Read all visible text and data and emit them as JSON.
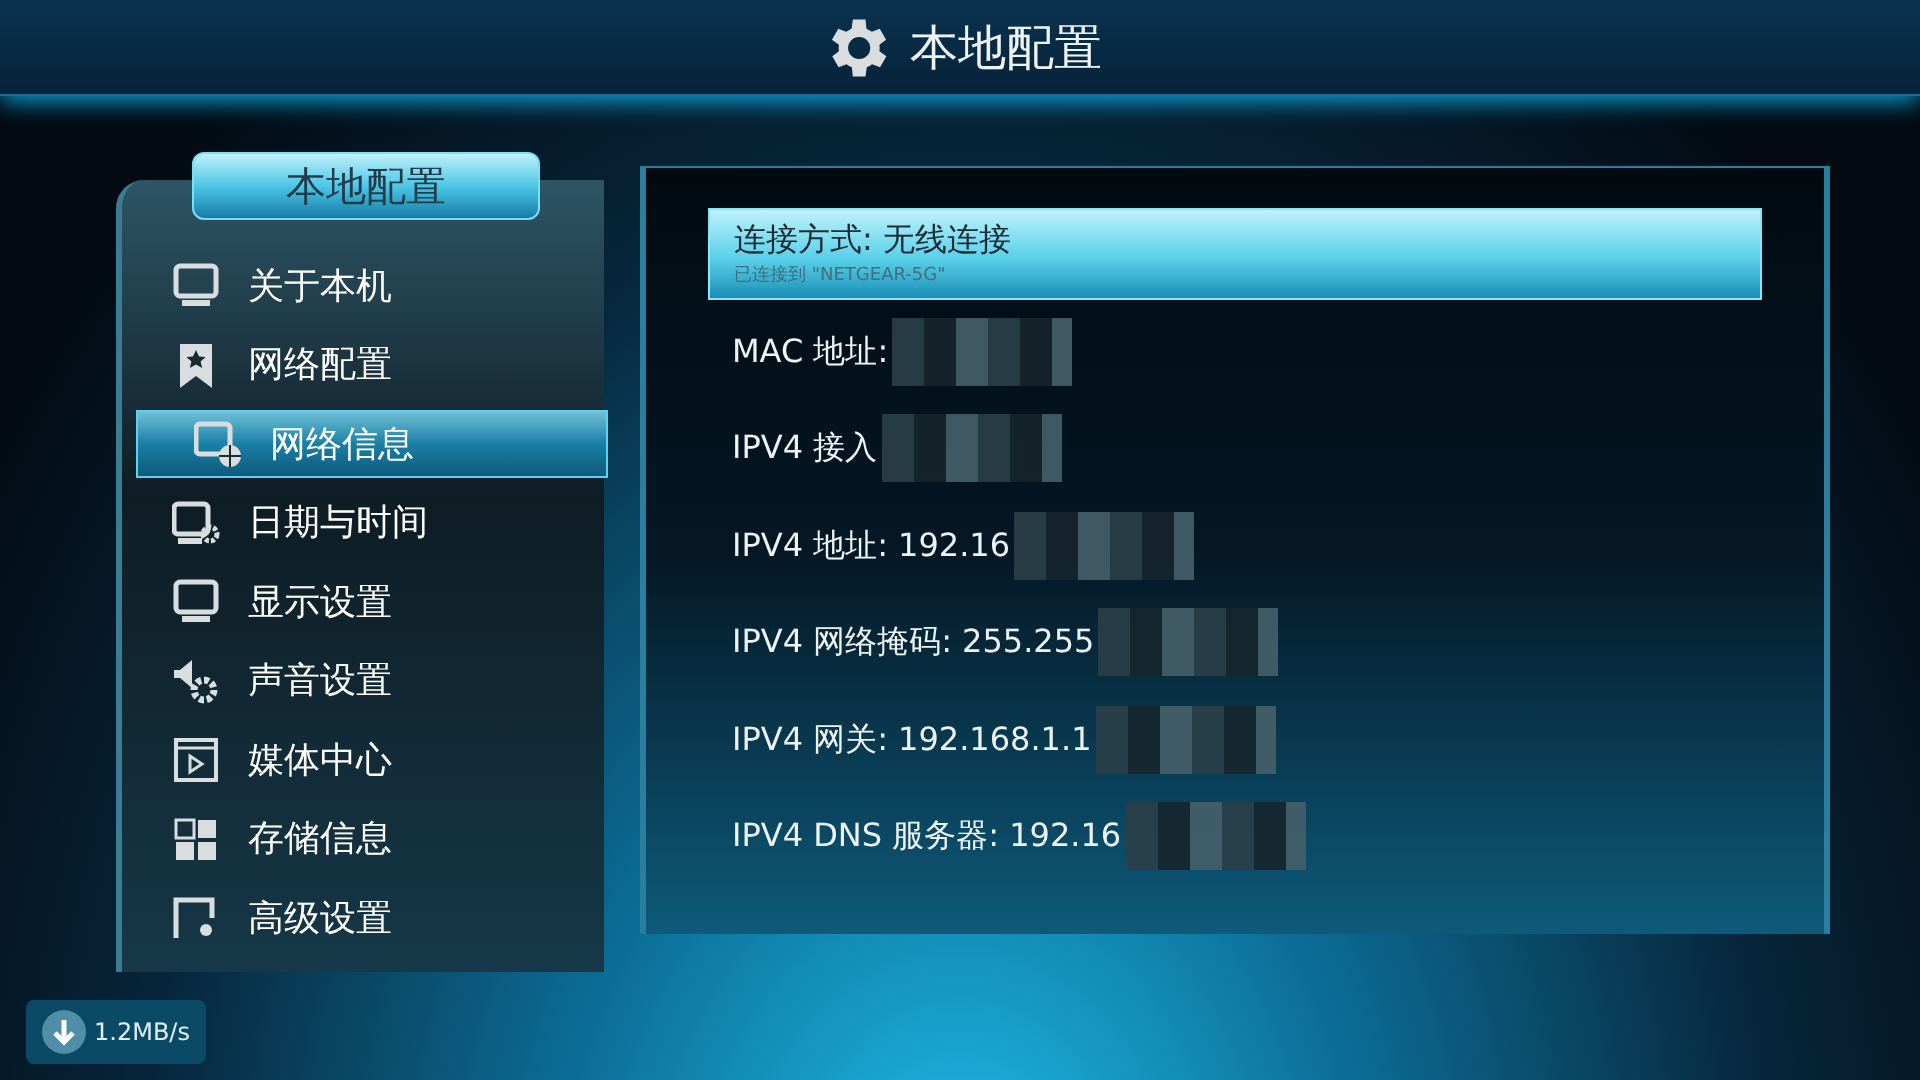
{
  "header": {
    "title": "本地配置"
  },
  "sidebar": {
    "title": "本地配置",
    "items": [
      {
        "label": "关于本机",
        "selected": false
      },
      {
        "label": "网络配置",
        "selected": false
      },
      {
        "label": "网络信息",
        "selected": true
      },
      {
        "label": "日期与时间",
        "selected": false
      },
      {
        "label": "显示设置",
        "selected": false
      },
      {
        "label": "声音设置",
        "selected": false
      },
      {
        "label": "媒体中心",
        "selected": false
      },
      {
        "label": "存储信息",
        "selected": false
      },
      {
        "label": "高级设置",
        "selected": false
      }
    ]
  },
  "info_rows": [
    {
      "label": "连接方式: 无线连接",
      "subtitle": "已连接到 \"NETGEAR-5G\"",
      "selected": true,
      "redacted": false
    },
    {
      "label": "MAC 地址:",
      "selected": false,
      "redacted": true
    },
    {
      "label": "IPV4 接入",
      "selected": false,
      "redacted": true
    },
    {
      "label": "IPV4 地址: 192.16",
      "selected": false,
      "redacted": true
    },
    {
      "label": "IPV4 网络掩码: 255.255",
      "selected": false,
      "redacted": true
    },
    {
      "label": "IPV4 网关: 192.168.1.1",
      "selected": false,
      "redacted": true
    },
    {
      "label": "IPV4 DNS 服务器: 192.16",
      "selected": false,
      "redacted": true
    }
  ],
  "speed": "1.2MB/s"
}
